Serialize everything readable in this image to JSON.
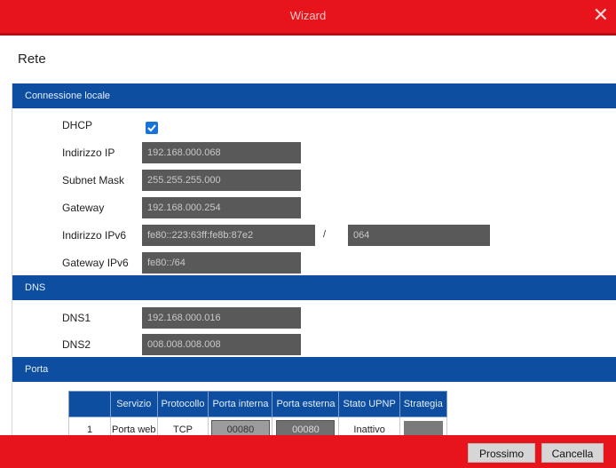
{
  "window": {
    "title": "Wizard",
    "close_icon": "close-icon"
  },
  "page": {
    "title": "Rete"
  },
  "local": {
    "title": "Connessione locale",
    "dhcp": {
      "label": "DHCP",
      "checked": true
    },
    "ip": {
      "label": "Indirizzo IP",
      "value": "192.168.000.068"
    },
    "subnet": {
      "label": "Subnet Mask",
      "value": "255.255.255.000"
    },
    "gateway": {
      "label": "Gateway",
      "value": "192.168.000.254"
    },
    "ipv6": {
      "label": "Indirizzo IPv6",
      "value": "fe80::223:63ff:fe8b:87e2",
      "separator": "/",
      "prefix": "064"
    },
    "gateway_ipv6": {
      "label": "Gateway IPv6",
      "value": "fe80::/64"
    }
  },
  "dns": {
    "title": "DNS",
    "dns1": {
      "label": "DNS1",
      "value": "192.168.000.016"
    },
    "dns2": {
      "label": "DNS2",
      "value": "008.008.008.008"
    }
  },
  "porta": {
    "title": "Porta",
    "headers": [
      "",
      "Servizio",
      "Protocollo",
      "Porta interna",
      "Porta esterna",
      "Stato UPNP",
      "Strategia"
    ],
    "rows": [
      {
        "index": "1",
        "service": "Porta web",
        "protocol": "TCP",
        "internal": "00080",
        "external": "00080",
        "status": "Inattivo",
        "strategy": ""
      }
    ]
  },
  "footer": {
    "next": "Prossimo",
    "cancel": "Cancella"
  },
  "colors": {
    "accent": "#e8141c",
    "section": "#0d4ea0",
    "field": "#595959"
  }
}
